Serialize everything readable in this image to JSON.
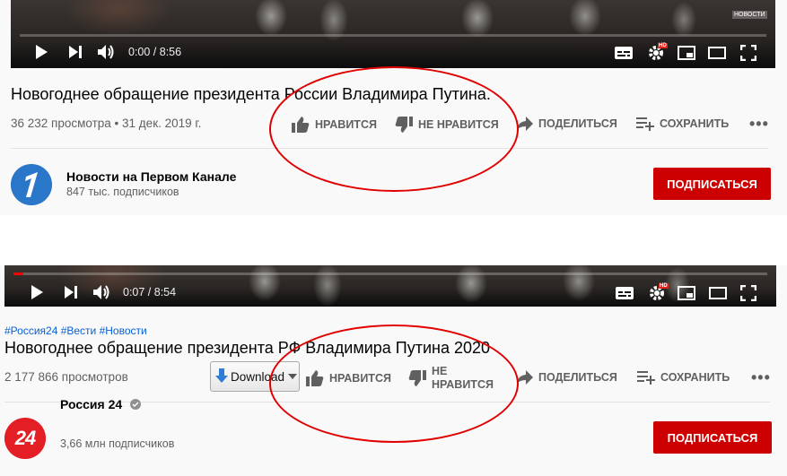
{
  "videos": [
    {
      "player": {
        "time": "0:00 / 8:56",
        "progress": 0.0,
        "logo": "НОВОСТИ"
      },
      "title": "Новогоднее обращение президента России Владимира Путина.",
      "views_date": "36 232 просмотра • 31 дек. 2019 г.",
      "actions": {
        "like": "НРАВИТСЯ",
        "dislike": "НЕ НРАВИТСЯ",
        "share": "ПОДЕЛИТЬСЯ",
        "save": "СОХРАНИТЬ"
      },
      "channel": {
        "name": "Новости на Первом Канале",
        "subscribers": "847 тыс. подписчиков"
      },
      "subscribe_label": "ПОДПИСАТЬСЯ"
    },
    {
      "player": {
        "time": "0:07 / 8:54",
        "progress": 0.013
      },
      "hashtags": "#Россия24 #Вести #Новости",
      "title": "Новогоднее обращение президента РФ Владимира Путина 2020",
      "views": "2 177 866 просмотров",
      "download_label": "Download",
      "actions": {
        "like": "НРАВИТСЯ",
        "dislike_line1": "НЕ",
        "dislike_line2": "НРАВИТСЯ",
        "share": "ПОДЕЛИТЬСЯ",
        "save": "СОХРАНИТЬ"
      },
      "channel": {
        "name": "Россия 24",
        "subscribers": "3,66 млн подписчиков",
        "avatar_text": "24"
      },
      "subscribe_label": "ПОДПИСАТЬСЯ"
    }
  ],
  "colors": {
    "subscribe": "#cc0000",
    "annotation": "#e00000",
    "hashtag": "#065fd4",
    "progress": "#ff0000"
  },
  "icons": [
    "play-icon",
    "next-icon",
    "volume-icon",
    "subtitles-icon",
    "settings-icon",
    "miniplayer-icon",
    "theater-icon",
    "fullscreen-icon",
    "like-icon",
    "dislike-icon",
    "share-icon",
    "save-icon",
    "more-icon",
    "verified-icon",
    "download-icon"
  ]
}
